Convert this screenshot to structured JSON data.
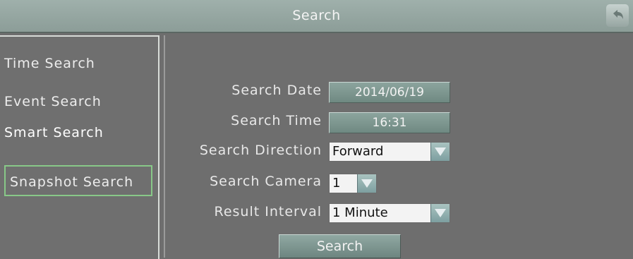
{
  "header": {
    "title": "Search"
  },
  "sidebar": {
    "items": [
      {
        "label": "Time Search"
      },
      {
        "label": "Event Search"
      },
      {
        "label": "Smart Search"
      },
      {
        "label": "Snapshot Search"
      }
    ]
  },
  "form": {
    "search_date": {
      "label": "Search Date",
      "value": "2014/06/19"
    },
    "search_time": {
      "label": "Search Time",
      "value": "16:31"
    },
    "search_direction": {
      "label": "Search Direction",
      "value": "Forward"
    },
    "search_camera": {
      "label": "Search Camera",
      "value": "1"
    },
    "result_interval": {
      "label": "Result Interval",
      "value": "1 Minute"
    },
    "search_button": "Search"
  },
  "icons": {
    "back": "back-arrow-icon",
    "dropdown": "chevron-down-icon"
  },
  "colors": {
    "accent": "#88c888",
    "titlebar": "#95a6a1"
  }
}
